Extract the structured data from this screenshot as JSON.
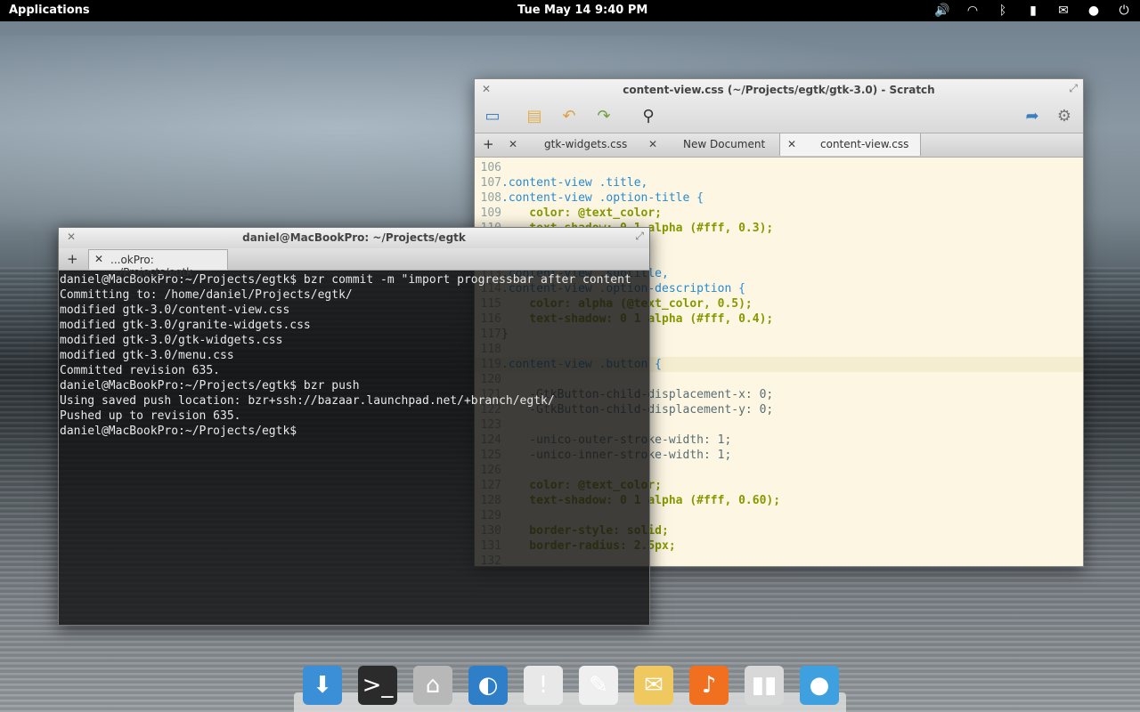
{
  "panel": {
    "applications": "Applications",
    "clock": "Tue May 14  9:40 PM",
    "tray": [
      "volume-icon",
      "wifi-icon",
      "bluetooth-icon",
      "battery-icon",
      "mail-icon",
      "user-icon",
      "power-icon"
    ]
  },
  "scratch": {
    "title": "content-view.css (~/Projects/egtk/gtk-3.0) - Scratch",
    "tabs": [
      {
        "label": "gtk-widgets.css"
      },
      {
        "label": "New Document"
      },
      {
        "label": "content-view.css"
      }
    ],
    "lines": [
      {
        "n": "106",
        "t": ""
      },
      {
        "n": "107",
        "t": ".content-view .title,"
      },
      {
        "n": "108",
        "t": ".content-view .option-title {"
      },
      {
        "n": "109",
        "t": "    color: @text_color;"
      },
      {
        "n": "110",
        "t": "    text-shadow: 0 1 alpha (#fff, 0.3);"
      },
      {
        "n": "111",
        "t": "}"
      },
      {
        "n": "112",
        "t": ""
      },
      {
        "n": "113",
        "t": ".content-view .subtitle,"
      },
      {
        "n": "114",
        "t": ".content-view .option-description {"
      },
      {
        "n": "115",
        "t": "    color: alpha (@text_color, 0.5);"
      },
      {
        "n": "116",
        "t": "    text-shadow: 0 1 alpha (#fff, 0.4);"
      },
      {
        "n": "117",
        "t": "}"
      },
      {
        "n": "118",
        "t": ""
      },
      {
        "n": "119",
        "t": ".content-view .button {"
      },
      {
        "n": "120",
        "t": ""
      },
      {
        "n": "121",
        "t": "    -GtkButton-child-displacement-x: 0;"
      },
      {
        "n": "122",
        "t": "    -GtkButton-child-displacement-y: 0;"
      },
      {
        "n": "123",
        "t": ""
      },
      {
        "n": "124",
        "t": "    -unico-outer-stroke-width: 1;"
      },
      {
        "n": "125",
        "t": "    -unico-inner-stroke-width: 1;"
      },
      {
        "n": "126",
        "t": ""
      },
      {
        "n": "127",
        "t": "    color: @text_color;"
      },
      {
        "n": "128",
        "t": "    text-shadow: 0 1 alpha (#fff, 0.60);"
      },
      {
        "n": "129",
        "t": ""
      },
      {
        "n": "130",
        "t": "    border-style: solid;"
      },
      {
        "n": "131",
        "t": "    border-radius: 2.5px;"
      },
      {
        "n": "132",
        "t": ""
      }
    ]
  },
  "terminal": {
    "title": "daniel@MacBookPro: ~/Projects/egtk",
    "tab_label": "...okPro: ~/Projects/egtk",
    "lines": [
      "daniel@MacBookPro:~/Projects/egtk$ bzr commit -m \"import progressbar after content",
      "Committing to: /home/daniel/Projects/egtk/",
      "modified gtk-3.0/content-view.css",
      "modified gtk-3.0/granite-widgets.css",
      "modified gtk-3.0/gtk-widgets.css",
      "modified gtk-3.0/menu.css",
      "Committed revision 635.",
      "daniel@MacBookPro:~/Projects/egtk$ bzr push",
      "Using saved push location: bzr+ssh://bazaar.launchpad.net/+branch/egtk/",
      "Pushed up to revision 635.",
      "daniel@MacBookPro:~/Projects/egtk$"
    ]
  },
  "dock": [
    {
      "name": "downloads-icon",
      "glyph": "⬇",
      "color": "#3b8fd6"
    },
    {
      "name": "terminal-icon",
      "glyph": ">_",
      "color": "#2b2b2b"
    },
    {
      "name": "files-icon",
      "glyph": "⌂",
      "color": "#b8b8b8"
    },
    {
      "name": "browser-icon",
      "glyph": "◐",
      "color": "#2f7fc8"
    },
    {
      "name": "chat-icon",
      "glyph": "!",
      "color": "#e8e8e8"
    },
    {
      "name": "text-editor-icon",
      "glyph": "✎",
      "color": "#efefef"
    },
    {
      "name": "mail-icon",
      "glyph": "✉",
      "color": "#f0c860"
    },
    {
      "name": "music-icon",
      "glyph": "♪",
      "color": "#f07020"
    },
    {
      "name": "settings-icon",
      "glyph": "▮▮",
      "color": "#d8d8d8"
    },
    {
      "name": "twitter-client-icon",
      "glyph": "●",
      "color": "#3fa0e0"
    }
  ]
}
